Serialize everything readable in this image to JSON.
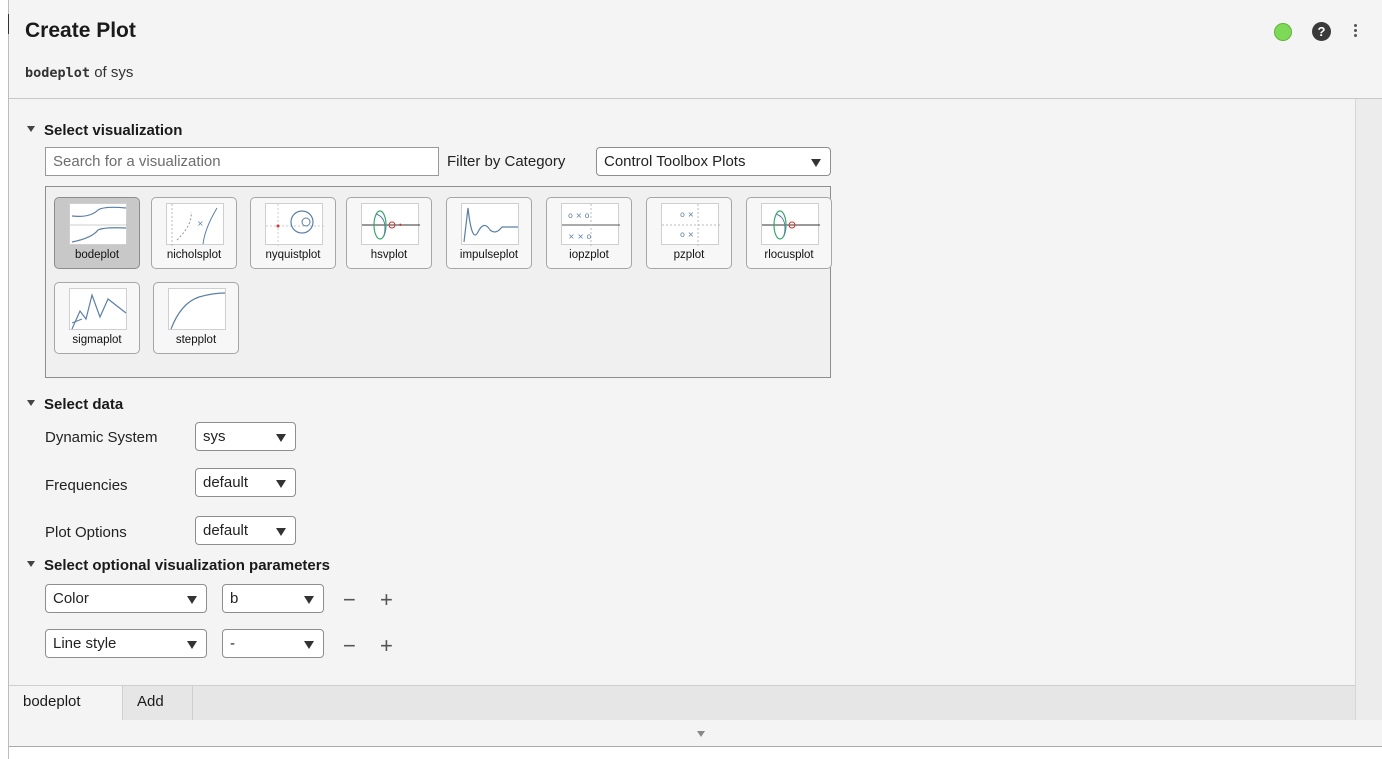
{
  "header": {
    "title": "Create Plot",
    "subtitle_code": "bodeplot",
    "subtitle_rest": " of sys",
    "help_glyph": "?",
    "status_color": "#7ed957"
  },
  "visualization": {
    "section_label": "Select visualization",
    "search_placeholder": "Search for a visualization",
    "filter_label": "Filter by Category",
    "filter_value": "Control Toolbox Plots",
    "tiles": [
      {
        "name": "bodeplot",
        "selected": true
      },
      {
        "name": "nicholsplot"
      },
      {
        "name": "nyquistplot"
      },
      {
        "name": "hsvplot"
      },
      {
        "name": "impulseplot"
      },
      {
        "name": "iopzplot"
      },
      {
        "name": "pzplot"
      },
      {
        "name": "rlocusplot"
      },
      {
        "name": "sigmaplot"
      },
      {
        "name": "stepplot"
      }
    ]
  },
  "data": {
    "section_label": "Select data",
    "dynamic_system_label": "Dynamic System",
    "dynamic_system_value": "sys",
    "frequencies_label": "Frequencies",
    "frequencies_value": "default",
    "plot_options_label": "Plot Options",
    "plot_options_value": "default"
  },
  "params": {
    "section_label": "Select optional visualization parameters",
    "rows": [
      {
        "param": "Color",
        "value": "b"
      },
      {
        "param": "Line style",
        "value": "-"
      }
    ],
    "minus": "−",
    "plus": "+"
  },
  "tabs": {
    "active": "bodeplot",
    "add": "Add"
  }
}
